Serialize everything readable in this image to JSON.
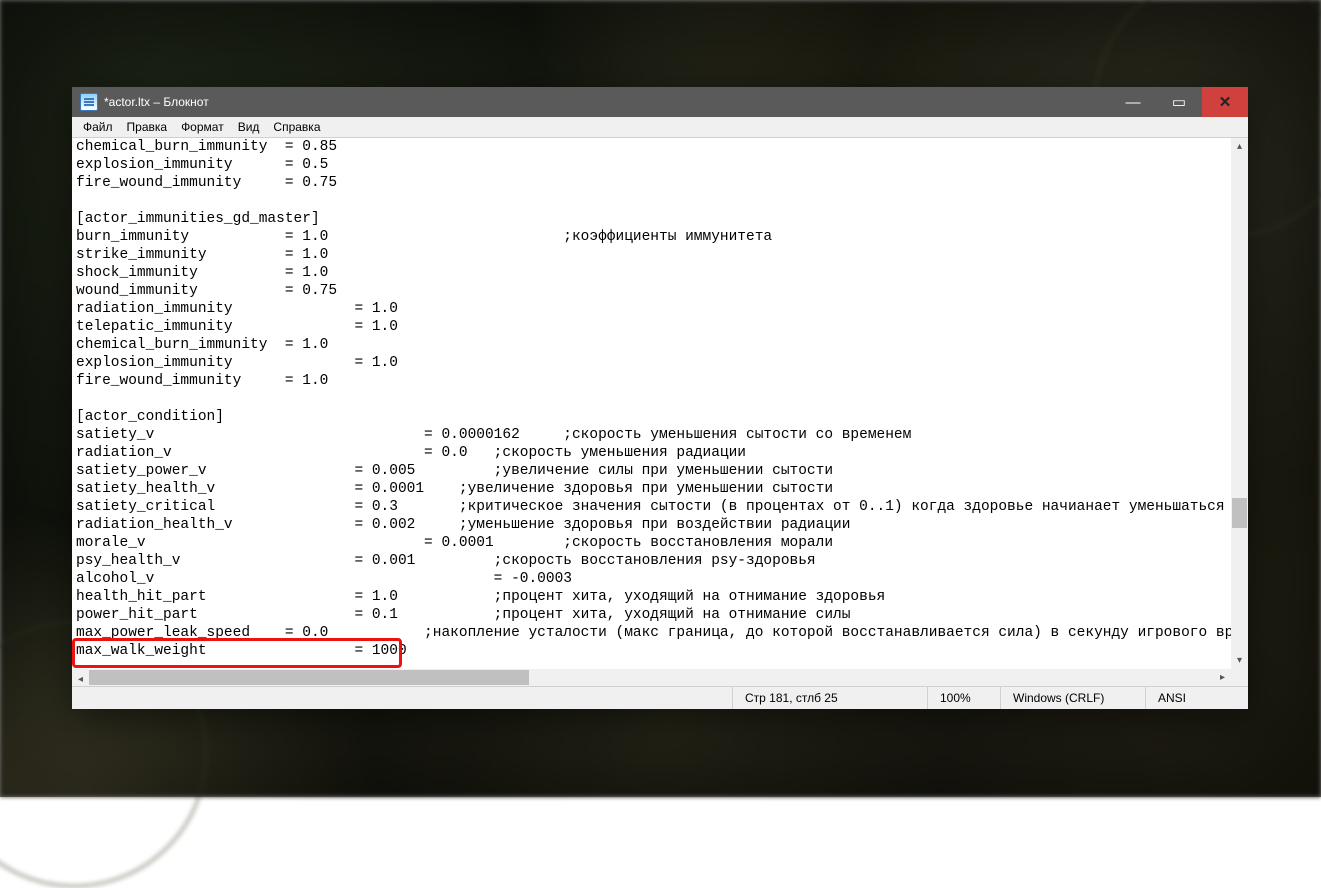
{
  "window": {
    "title": "*actor.ltx – Блокнот"
  },
  "menu": {
    "file": "Файл",
    "edit": "Правка",
    "format": "Формат",
    "view": "Вид",
    "help": "Справка"
  },
  "status": {
    "pos": "Стр 181, стлб 25",
    "zoom": "100%",
    "eol": "Windows (CRLF)",
    "enc": "ANSI"
  },
  "highlight_line": "max_walk_weight",
  "lines": [
    "chemical_burn_immunity  = 0.85",
    "explosion_immunity      = 0.5",
    "fire_wound_immunity     = 0.75",
    "",
    "[actor_immunities_gd_master]",
    "burn_immunity           = 1.0                           ;коэффициенты иммунитета",
    "strike_immunity         = 1.0",
    "shock_immunity          = 1.0",
    "wound_immunity          = 0.75",
    "radiation_immunity              = 1.0",
    "telepatic_immunity              = 1.0",
    "chemical_burn_immunity  = 1.0",
    "explosion_immunity              = 1.0",
    "fire_wound_immunity     = 1.0",
    "",
    "[actor_condition]",
    "satiety_v                               = 0.0000162     ;скорость уменьшения сытости со временем",
    "radiation_v                             = 0.0   ;скорость уменьшения радиации",
    "satiety_power_v                 = 0.005         ;увеличение силы при уменьшении сытости",
    "satiety_health_v                = 0.0001    ;увеличение здоровья при уменьшении сытости",
    "satiety_critical                = 0.3       ;критическое значения сытости (в процентах от 0..1) когда здоровье начианает уменьшаться",
    "radiation_health_v              = 0.002     ;уменьшение здоровья при воздействии радиации",
    "morale_v                                = 0.0001        ;скорость восстановления морали",
    "psy_health_v                    = 0.001         ;скорость восстановления psy-здоровья",
    "alcohol_v                                       = -0.0003",
    "health_hit_part                 = 1.0           ;процент хита, уходящий на отнимание здоровья",
    "power_hit_part                  = 0.1           ;процент хита, уходящий на отнимание силы",
    "max_power_leak_speed    = 0.0           ;накопление усталости (макс граница, до которой восстанавливается сила) в секунду игрового времени",
    "max_walk_weight                 = 1000"
  ]
}
